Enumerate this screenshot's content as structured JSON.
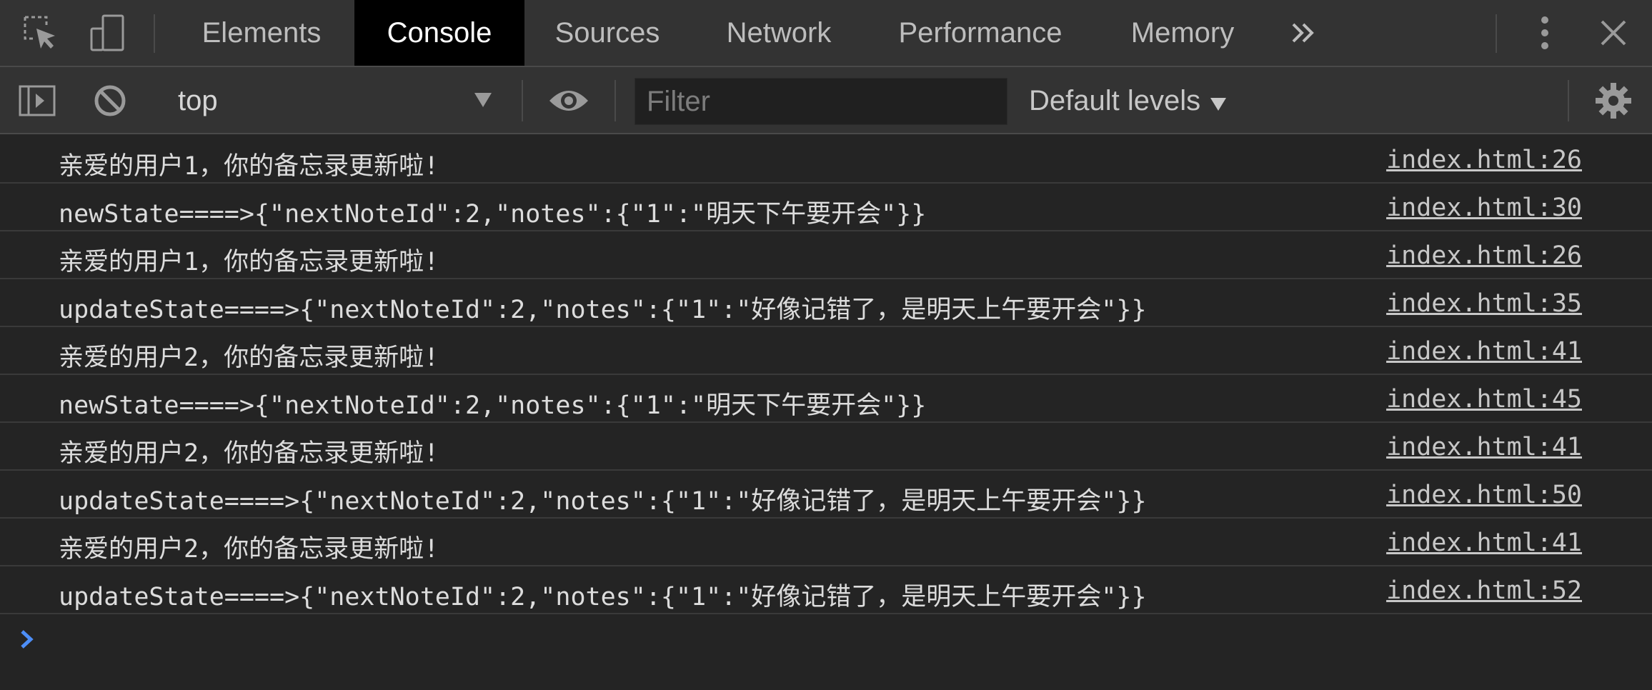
{
  "tabbar": {
    "tabs": [
      {
        "label": "Elements"
      },
      {
        "label": "Console",
        "active": true
      },
      {
        "label": "Sources"
      },
      {
        "label": "Network"
      },
      {
        "label": "Performance"
      },
      {
        "label": "Memory"
      }
    ],
    "icons": [
      "inspect-element-icon",
      "device-toolbar-icon",
      "more-tabs-icon",
      "kebab-menu-icon",
      "close-icon"
    ]
  },
  "toolbar": {
    "context": "top",
    "filter_placeholder": "Filter",
    "filter_value": "",
    "levels_label": "Default levels",
    "icons": [
      "sidebar-toggle-icon",
      "clear-console-icon",
      "dropdown-arrow-icon",
      "eye-icon",
      "settings-gear-icon"
    ]
  },
  "console": {
    "messages": [
      {
        "text": "亲爱的用户1，你的备忘录更新啦!",
        "source": "index.html:26"
      },
      {
        "text": "newState====>{\"nextNoteId\":2,\"notes\":{\"1\":\"明天下午要开会\"}}",
        "source": "index.html:30"
      },
      {
        "text": "亲爱的用户1，你的备忘录更新啦!",
        "source": "index.html:26"
      },
      {
        "text": "updateState====>{\"nextNoteId\":2,\"notes\":{\"1\":\"好像记错了，是明天上午要开会\"}}",
        "source": "index.html:35"
      },
      {
        "text": "亲爱的用户2，你的备忘录更新啦!",
        "source": "index.html:41"
      },
      {
        "text": "newState====>{\"nextNoteId\":2,\"notes\":{\"1\":\"明天下午要开会\"}}",
        "source": "index.html:45"
      },
      {
        "text": "亲爱的用户2，你的备忘录更新啦!",
        "source": "index.html:41"
      },
      {
        "text": "updateState====>{\"nextNoteId\":2,\"notes\":{\"1\":\"好像记错了，是明天上午要开会\"}}",
        "source": "index.html:50"
      },
      {
        "text": "亲爱的用户2，你的备忘录更新啦!",
        "source": "index.html:41"
      },
      {
        "text": "updateState====>{\"nextNoteId\":2,\"notes\":{\"1\":\"好像记错了，是明天上午要开会\"}}",
        "source": "index.html:52"
      }
    ],
    "prompt_icon": "prompt-chevron-icon"
  },
  "colors": {
    "accent_blue": "#4d8ef7",
    "background": "#242424",
    "toolbar": "#333333",
    "active_tab": "#000000"
  }
}
